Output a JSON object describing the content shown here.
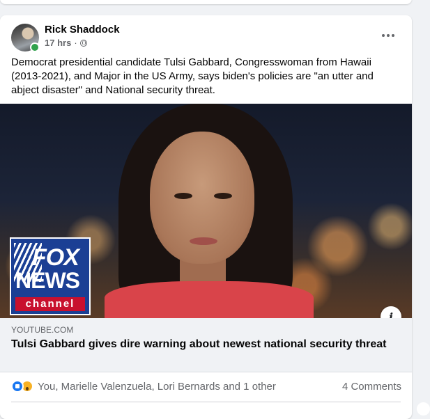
{
  "post": {
    "author": "Rick Shaddock",
    "time": "17 hrs",
    "meta_separator": "·",
    "text": "Democrat presidential candidate Tulsi Gabbard, Congresswoman from Hawaii (2013-2021), and Major in the US Army, says biden's policies are \"an utter and abject disaster\" and National security threat.",
    "media": {
      "logo_fox": "FOX",
      "logo_news": "NEWS",
      "logo_channel": "channel",
      "info_glyph": "i"
    },
    "link": {
      "domain": "YOUTUBE.COM",
      "title": "Tulsi Gabbard gives dire warning about newest national security threat"
    },
    "reactions": {
      "icons": [
        "like-icon",
        "wow-icon"
      ],
      "reactors": "You, Marielle Valenzuela, Lori Bernards and 1 other",
      "comments": "4 Comments"
    }
  },
  "colors": {
    "accent": "#1877f2",
    "online": "#31a24c",
    "text_secondary": "#65676b"
  }
}
